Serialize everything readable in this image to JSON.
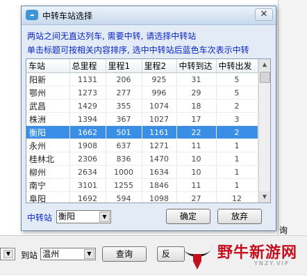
{
  "dialog": {
    "title": "中转车站选择",
    "close_glyph": "✕",
    "info_line1": "两站之间无直达列车, 需要中转, 请选择中转站",
    "info_line2": "单击标题可按相关内容排序, 选中中转站后蓝色车次表示中转",
    "columns": [
      "车站",
      "总里程",
      "里程1",
      "里程2",
      "中转到达",
      "中转出发"
    ],
    "rows": [
      {
        "station": "阳新",
        "total": "1131",
        "m1": "206",
        "m2": "925",
        "arrive": "31",
        "depart": "5"
      },
      {
        "station": "鄂州",
        "total": "1273",
        "m1": "277",
        "m2": "996",
        "arrive": "29",
        "depart": "5"
      },
      {
        "station": "武昌",
        "total": "1429",
        "m1": "355",
        "m2": "1074",
        "arrive": "18",
        "depart": "2"
      },
      {
        "station": "株洲",
        "total": "1394",
        "m1": "367",
        "m2": "1027",
        "arrive": "17",
        "depart": "3"
      },
      {
        "station": "衡阳",
        "total": "1662",
        "m1": "501",
        "m2": "1161",
        "arrive": "22",
        "depart": "2",
        "selected": true
      },
      {
        "station": "永州",
        "total": "1908",
        "m1": "637",
        "m2": "1271",
        "arrive": "11",
        "depart": "1"
      },
      {
        "station": "桂林北",
        "total": "2306",
        "m1": "836",
        "m2": "1470",
        "arrive": "10",
        "depart": "1"
      },
      {
        "station": "柳州",
        "total": "2634",
        "m1": "1000",
        "m2": "1634",
        "arrive": "10",
        "depart": "1"
      },
      {
        "station": "南宁",
        "total": "3101",
        "m1": "1255",
        "m2": "1846",
        "arrive": "11",
        "depart": "1"
      },
      {
        "station": "阜阳",
        "total": "1692",
        "m1": "594",
        "m2": "1098",
        "arrive": "27",
        "depart": "12"
      }
    ],
    "relay_label": "中转站",
    "relay_value": "衡阳",
    "ok_label": "确定",
    "giveup_label": "放弃"
  },
  "background": {
    "to_station_label": "到站",
    "to_station_value": "温州",
    "query_label": "查询",
    "reverse_label": "反",
    "side_text": "询"
  },
  "watermark": {
    "text": "野牛新游网",
    "sub": "YNZY.VIP"
  },
  "icons": {
    "dropdown_arrow": "▼",
    "scroll_up": "▲",
    "scroll_down": "▼"
  },
  "colors": {
    "info_text": "#0a24c4",
    "selected_row": "#3a8ee6",
    "watermark": "#c40f1e"
  }
}
